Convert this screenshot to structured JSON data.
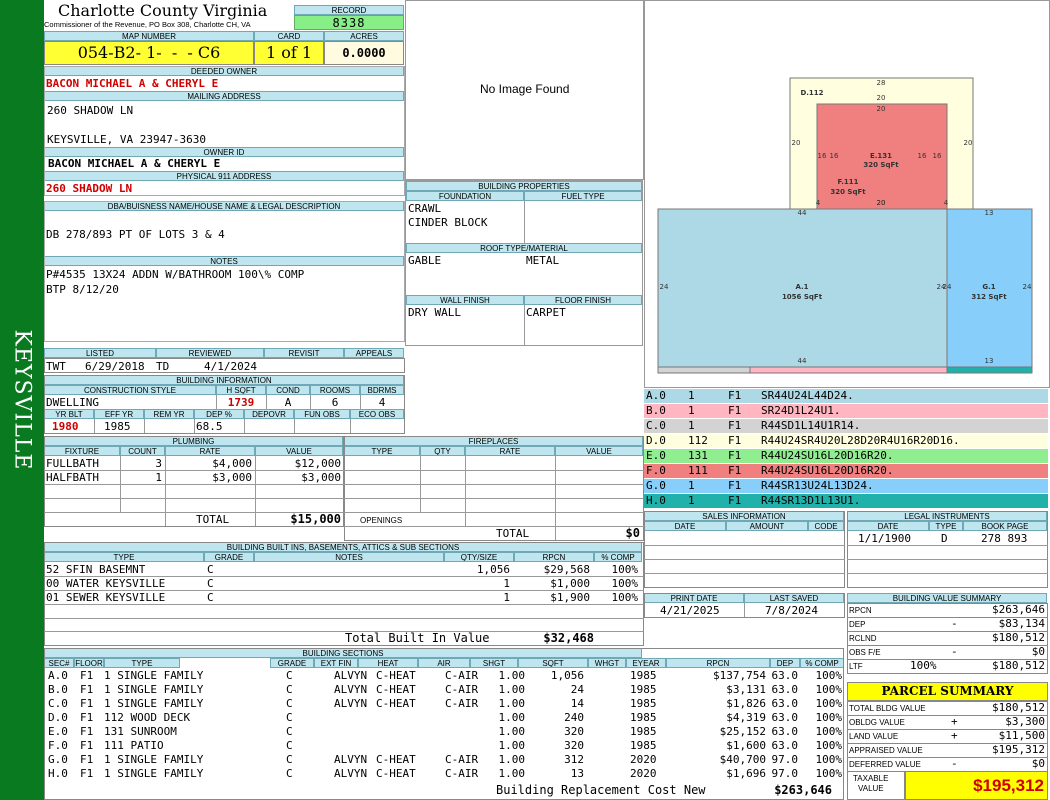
{
  "sidebar": {
    "text": "KEYSVILLE"
  },
  "header": {
    "county": "Charlotte County Virginia",
    "subtitle": "Commissioner of the Revenue, PO Box 308, Charlotte CH, VA",
    "record_label": "RECORD",
    "record": "8338"
  },
  "map": {
    "map_label": "MAP NUMBER",
    "map_number": "054-B2- 1-  -  - C6",
    "card_label": "CARD",
    "card": "1 of 1",
    "acres_label": "ACRES",
    "acres": "0.0000"
  },
  "owner": {
    "deeded_label": "DEEDED OWNER",
    "deeded": "BACON MICHAEL A & CHERYL E",
    "mailing_label": "MAILING ADDRESS",
    "addr1": "260 SHADOW LN",
    "addr2": "KEYSVILLE, VA 23947-3630",
    "owner_id_label": "OWNER ID",
    "owner_id": "BACON MICHAEL A & CHERYL E",
    "phys_label": "PHYSICAL 911 ADDRESS",
    "phys": "260 SHADOW LN"
  },
  "legal": {
    "label": "DBA/BUISNESS NAME/HOUSE NAME & LEGAL DESCRIPTION",
    "text": "DB 278/893 PT OF LOTS 3 & 4"
  },
  "notes": {
    "label": "NOTES",
    "line1": "P#4535 13X24 ADDN W/BATHROOM 100\\% COMP",
    "line2": "BTP 8/12/20"
  },
  "image": {
    "text": "No Image Found"
  },
  "bp": {
    "label": "BUILDING PROPERTIES",
    "foundation_label": "FOUNDATION",
    "fuel_label": "FUEL TYPE",
    "foundation1": "CRAWL",
    "foundation2": "CINDER BLOCK",
    "roof_label": "ROOF TYPE/MATERIAL",
    "roof_type": "GABLE",
    "roof_mat": "METAL",
    "wall_label": "WALL FINISH",
    "floor_label": "FLOOR FINISH",
    "wall": "DRY WALL",
    "floor": "CARPET"
  },
  "dates": {
    "listed_label": "LISTED",
    "reviewed_label": "REVIEWED",
    "revisit_label": "REVISIT",
    "appeals_label": "APPEALS",
    "listed_by": "TWT",
    "listed": "6/29/2018",
    "reviewed_by": "TD",
    "reviewed": "4/1/2024"
  },
  "bi": {
    "label": "BUILDING INFORMATION",
    "cs_label": "CONSTRUCTION STYLE",
    "hsqft_label": "H SQFT",
    "cond_label": "COND",
    "rooms_label": "ROOMS",
    "bdrms_label": "BDRMS",
    "style": "DWELLING",
    "hsqft": "1739",
    "cond": "A",
    "rooms": "6",
    "bdrms": "4",
    "yrblt_label": "YR BLT",
    "effyr_label": "EFF YR",
    "remyr_label": "REM YR",
    "dep_label": "DEP %",
    "depovr_label": "DEPOVR",
    "funobs_label": "FUN OBS",
    "ecoobs_label": "ECO OBS",
    "yrblt": "1980",
    "effyr": "1985",
    "dep": "68.5"
  },
  "plumbing": {
    "label": "PLUMBING",
    "h_fixture": "FIXTURE",
    "h_count": "COUNT",
    "h_rate": "RATE",
    "h_value": "VALUE",
    "rows": [
      {
        "fixture": "FULLBATH",
        "count": "3",
        "rate": "$4,000",
        "value": "$12,000"
      },
      {
        "fixture": "HALFBATH",
        "count": "1",
        "rate": "$3,000",
        "value": "$3,000"
      }
    ],
    "total_label": "TOTAL",
    "total": "$15,000"
  },
  "fireplaces": {
    "label": "FIREPLACES",
    "h_type": "TYPE",
    "h_qty": "QTY",
    "h_rate": "RATE",
    "h_value": "VALUE",
    "openings_label": "OPENINGS",
    "total_label": "TOTAL",
    "total": "$0"
  },
  "builtins": {
    "label": "BUILDING BUILT INS, BASEMENTS, ATTICS & SUB SECTIONS",
    "h_type": "TYPE",
    "h_grade": "GRADE",
    "h_notes": "NOTES",
    "h_qty": "QTY/SIZE",
    "h_rcn": "RPCN",
    "h_comp": "% COMP",
    "rows": [
      {
        "type": "52 SFIN BASEMNT",
        "grade": "C",
        "qty": "1,056",
        "rcn": "$29,568",
        "comp": "100%"
      },
      {
        "type": "00 WATER KEYSVILLE",
        "grade": "C",
        "qty": "1",
        "rcn": "$1,000",
        "comp": "100%"
      },
      {
        "type": "01 SEWER KEYSVILLE",
        "grade": "C",
        "qty": "1",
        "rcn": "$1,900",
        "comp": "100%"
      }
    ],
    "total_label": "Total Built In Value",
    "total": "$32,468"
  },
  "sections": {
    "label": "BUILDING SECTIONS",
    "headers": [
      "SEC#",
      "FLOOR",
      "TYPE",
      "GRADE",
      "EXT FIN",
      "HEAT",
      "AIR",
      "SHGT",
      "SQFT",
      "WHGT",
      "EYEAR",
      "RPCN",
      "DEP",
      "% COMP"
    ],
    "rows": [
      {
        "sec": "A.0",
        "floor": "F1",
        "type": "1 SINGLE FAMILY",
        "grade": "C",
        "ext": "ALVYN",
        "heat": "C-HEAT",
        "air": "C-AIR",
        "shgt": "1.00",
        "sqft": "1,056",
        "eyear": "1985",
        "rcn": "$137,754",
        "dep": "63.0",
        "comp": "100%"
      },
      {
        "sec": "B.0",
        "floor": "F1",
        "type": "1 SINGLE FAMILY",
        "grade": "C",
        "ext": "ALVYN",
        "heat": "C-HEAT",
        "air": "C-AIR",
        "shgt": "1.00",
        "sqft": "24",
        "eyear": "1985",
        "rcn": "$3,131",
        "dep": "63.0",
        "comp": "100%"
      },
      {
        "sec": "C.0",
        "floor": "F1",
        "type": "1 SINGLE FAMILY",
        "grade": "C",
        "ext": "ALVYN",
        "heat": "C-HEAT",
        "air": "C-AIR",
        "shgt": "1.00",
        "sqft": "14",
        "eyear": "1985",
        "rcn": "$1,826",
        "dep": "63.0",
        "comp": "100%"
      },
      {
        "sec": "D.0",
        "floor": "F1",
        "type": "112 WOOD DECK",
        "grade": "C",
        "ext": "",
        "heat": "",
        "air": "",
        "shgt": "1.00",
        "sqft": "240",
        "eyear": "1985",
        "rcn": "$4,319",
        "dep": "63.0",
        "comp": "100%"
      },
      {
        "sec": "E.0",
        "floor": "F1",
        "type": "131 SUNROOM",
        "grade": "C",
        "ext": "",
        "heat": "",
        "air": "",
        "shgt": "1.00",
        "sqft": "320",
        "eyear": "1985",
        "rcn": "$25,152",
        "dep": "63.0",
        "comp": "100%"
      },
      {
        "sec": "F.0",
        "floor": "F1",
        "type": "111 PATIO",
        "grade": "C",
        "ext": "",
        "heat": "",
        "air": "",
        "shgt": "1.00",
        "sqft": "320",
        "eyear": "1985",
        "rcn": "$1,600",
        "dep": "63.0",
        "comp": "100%"
      },
      {
        "sec": "G.0",
        "floor": "F1",
        "type": "1 SINGLE FAMILY",
        "grade": "C",
        "ext": "ALVYN",
        "heat": "C-HEAT",
        "air": "C-AIR",
        "shgt": "1.00",
        "sqft": "312",
        "eyear": "2020",
        "rcn": "$40,700",
        "dep": "97.0",
        "comp": "100%"
      },
      {
        "sec": "H.0",
        "floor": "F1",
        "type": "1 SINGLE FAMILY",
        "grade": "C",
        "ext": "ALVYN",
        "heat": "C-HEAT",
        "air": "C-AIR",
        "shgt": "1.00",
        "sqft": "13",
        "eyear": "2020",
        "rcn": "$1,696",
        "dep": "97.0",
        "comp": "100%"
      }
    ],
    "total_label": "Building Replacement Cost New",
    "total": "$263,646"
  },
  "sketch": {
    "labels": [
      {
        "t": "D.112"
      },
      {
        "t": "E.131"
      },
      {
        "t": "320 SqFt"
      },
      {
        "t": "F.111"
      },
      {
        "t": "320 SqFt"
      },
      {
        "t": "A.1"
      },
      {
        "t": "1056 SqFt"
      },
      {
        "t": "G.1"
      },
      {
        "t": "312 SqFt"
      }
    ],
    "dims": [
      "28",
      "20",
      "20",
      "20",
      "16",
      "16",
      "16",
      "16",
      "20",
      "20",
      "4",
      "44",
      "4",
      "20",
      "13",
      "24",
      "24",
      "24",
      "24",
      "44",
      "13"
    ]
  },
  "legend": [
    {
      "sec": "A.0",
      "code": "1",
      "floor": "F1",
      "desc": "SR44U24L44D24.",
      "color": "#add8e6"
    },
    {
      "sec": "B.0",
      "code": "1",
      "floor": "F1",
      "desc": "SR24D1L24U1.",
      "color": "#ffb6c1"
    },
    {
      "sec": "C.0",
      "code": "1",
      "floor": "F1",
      "desc": "R44SD1L14U1R14.",
      "color": "#d3d3d3"
    },
    {
      "sec": "D.0",
      "code": "112",
      "floor": "F1",
      "desc": "R44U24SR4U20L28D20R4U16R20D16.",
      "color": "#ffffe0"
    },
    {
      "sec": "E.0",
      "code": "131",
      "floor": "F1",
      "desc": "R44U24SU16L20D16R20.",
      "color": "#90ee90"
    },
    {
      "sec": "F.0",
      "code": "111",
      "floor": "F1",
      "desc": "R44U24SU16L20D16R20.",
      "color": "#f08080"
    },
    {
      "sec": "G.0",
      "code": "1",
      "floor": "F1",
      "desc": "R44SR13U24L13D24.",
      "color": "#87cefa"
    },
    {
      "sec": "H.0",
      "code": "1",
      "floor": "F1",
      "desc": "R44SR13D1L13U1.",
      "color": "#20b2aa"
    }
  ],
  "sales": {
    "label": "SALES INFORMATION",
    "h_date": "DATE",
    "h_amount": "AMOUNT",
    "h_code": "CODE"
  },
  "legal_inst": {
    "label": "LEGAL INSTRUMENTS",
    "h_date": "DATE",
    "h_type": "TYPE",
    "h_page": "BOOK PAGE",
    "date": "1/1/1900",
    "type": "D",
    "page": "278 893"
  },
  "print": {
    "print_label": "PRINT DATE",
    "print_date": "4/21/2025",
    "saved_label": "LAST SAVED",
    "saved": "7/8/2024"
  },
  "bvs": {
    "label": "BUILDING VALUE SUMMARY",
    "rows": [
      {
        "k": "RPCN",
        "s": "",
        "v": "$263,646"
      },
      {
        "k": "DEP",
        "s": "-",
        "v": "$83,134"
      },
      {
        "k": "RCLND",
        "s": "",
        "v": "$180,512"
      },
      {
        "k": "OBS F/E",
        "s": "-",
        "v": "$0"
      },
      {
        "k": "LTF",
        "p": "100%",
        "s": "",
        "v": "$180,512"
      }
    ]
  },
  "parcel": {
    "label": "PARCEL SUMMARY",
    "rows": [
      {
        "k": "TOTAL BLDG VALUE",
        "s": "",
        "v": "$180,512"
      },
      {
        "k": "OBLDG VALUE",
        "s": "+",
        "v": "$3,300"
      },
      {
        "k": "LAND VALUE",
        "s": "+",
        "v": "$11,500"
      },
      {
        "k": "APPRAISED VALUE",
        "s": "",
        "v": "$195,312"
      },
      {
        "k": "DEFERRED VALUE",
        "s": "-",
        "v": "$0"
      }
    ],
    "taxable_label1": "TAXABLE",
    "taxable_label2": "VALUE",
    "taxable": "$195,312"
  },
  "colors": {
    "sidebar": "#0a7a20",
    "header_bg": "#bfe6ee",
    "map_bg": "#ffff33",
    "record_bg": "#88ee88",
    "taxable_bg": "#ffff00"
  }
}
